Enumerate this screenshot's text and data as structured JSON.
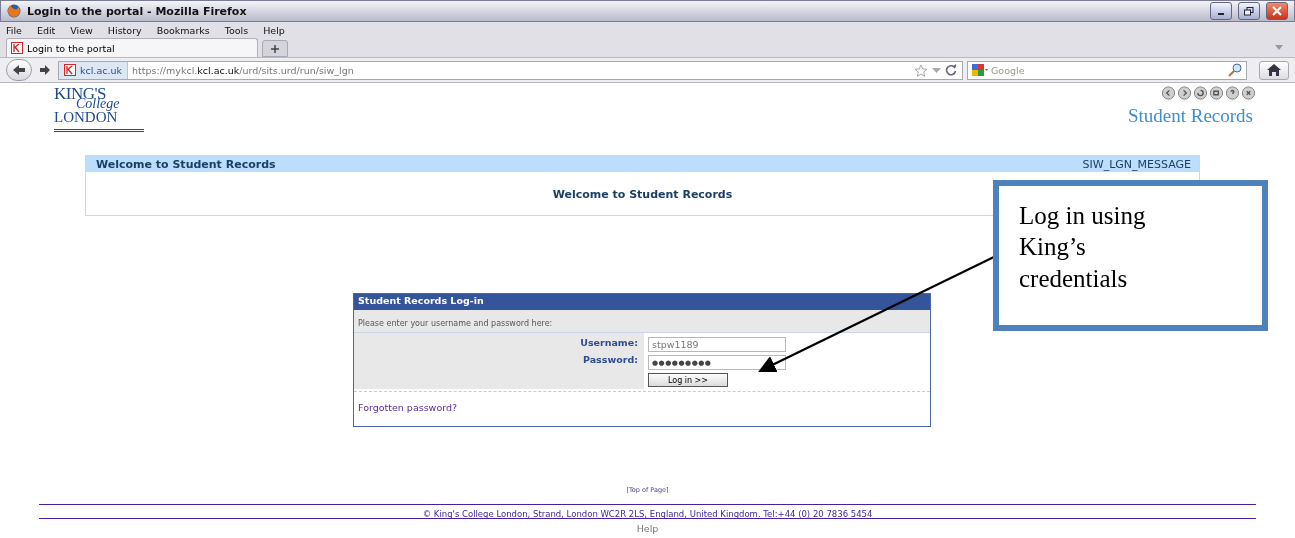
{
  "window": {
    "title": "Login to the portal - Mozilla Firefox"
  },
  "menu": [
    "File",
    "Edit",
    "View",
    "History",
    "Bookmarks",
    "Tools",
    "Help"
  ],
  "tabs": [
    {
      "label": "Login to the portal",
      "selected": true
    }
  ],
  "address_bar": {
    "site": "kcl.ac.uk",
    "url_prefix": "https://mykcl.",
    "url_domain": "kcl.ac.uk",
    "url_path": "/urd/sits.urd/run/siw_lgn"
  },
  "search": {
    "placeholder": "Google"
  },
  "logo": {
    "line_1": "KING'S",
    "line_2": "College",
    "line_3": "LONDON"
  },
  "site_title": "Student Records",
  "welcome_panel": {
    "title": "Welcome to Student Records",
    "code": "SIW_LGN_MESSAGE",
    "message": "Welcome to Student Records"
  },
  "login": {
    "title": "Student Records Log-in",
    "instruction": "Please enter your username and password here:",
    "username_label": "Username:",
    "username": "stpw1189",
    "password_label": "Password:",
    "password": "●●●●●●●●●",
    "button": "Log in >>",
    "forgot_link": "Forgotten password?"
  },
  "top_link": "[Top of Page]",
  "footer": {
    "copyright": "© King's College London, Strand, London WC2R 2LS, England, United Kingdom. Tel:+44 (0) 20 7836 5454",
    "help": "Help"
  },
  "callout": {
    "text": "Log in using King’s credentials"
  }
}
